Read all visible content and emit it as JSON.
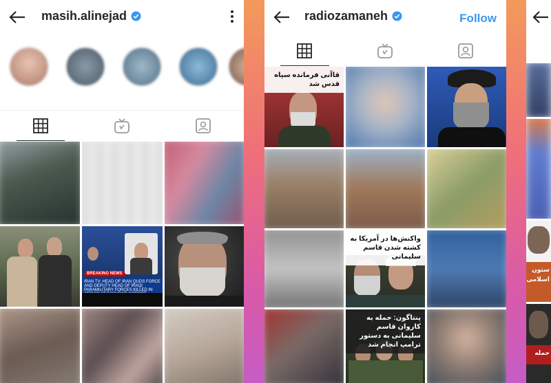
{
  "panel1": {
    "username": "masih.alinejad",
    "highlights": [
      "",
      "",
      "",
      "",
      ""
    ],
    "news_breaking": "BREAKING NEWS",
    "news_ticker": "IRAN TV: HEAD OF IRAN QUDS FORCE AND DEPUTY HEAD OF IRAQI PARAMILITARY FORCES KILLED IN ATTACK AT BAGHDAD AIRPORT"
  },
  "panel2": {
    "username": "radiozamaneh",
    "follow_label": "Follow",
    "post1_title": "قاآنی فرمانده سپاه قدس شد",
    "post2_title": "واکنش‌ها در آمریکا به کشته شدن قاسم سلیمانی",
    "post3_title": "پنتاگون: حمله به کاروان قاسم سلیمانی به دستور ترامپ انجام شد"
  },
  "panel3": {
    "snippet1": "ستون",
    "snippet2": "اسلامی",
    "snippet3": "حمله"
  },
  "colors": {
    "verified": "#3897f0",
    "follow": "#3897f0",
    "news_blue": "#0e3b8e",
    "breaking_red": "#cc0000"
  }
}
